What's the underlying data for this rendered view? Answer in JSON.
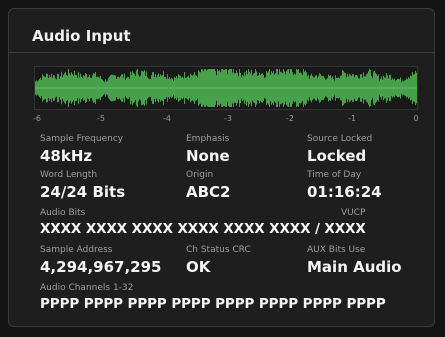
{
  "title": "Audio Input",
  "scale": [
    "-6",
    "-5",
    "-4",
    "-3",
    "-2",
    "-1",
    "0"
  ],
  "waveform_color": "#4caf50",
  "fields": {
    "sample_frequency": {
      "label": "Sample Frequency",
      "value": "48kHz"
    },
    "emphasis": {
      "label": "Emphasis",
      "value": "None"
    },
    "source_locked": {
      "label": "Source Locked",
      "value": "Locked"
    },
    "word_length": {
      "label": "Word Length",
      "value": "24/24 Bits"
    },
    "origin": {
      "label": "Origin",
      "value": "ABC2"
    },
    "time_of_day": {
      "label": "Time of Day",
      "value": "01:16:24"
    },
    "audio_bits": {
      "label": "Audio Bits",
      "vucp_label": "VUCP",
      "value": "XXXX XXXX XXXX XXXX XXXX XXXX / XXXX"
    },
    "sample_address": {
      "label": "Sample Address",
      "value": "4,294,967,295"
    },
    "ch_status_crc": {
      "label": "Ch Status CRC",
      "value": "OK"
    },
    "aux_bits_use": {
      "label": "AUX Bits Use",
      "value": "Main Audio"
    },
    "audio_channels": {
      "label": "Audio Channels 1-32",
      "value": "PPPP PPPP PPPP PPPP PPPP PPPP PPPP PPPP"
    }
  }
}
